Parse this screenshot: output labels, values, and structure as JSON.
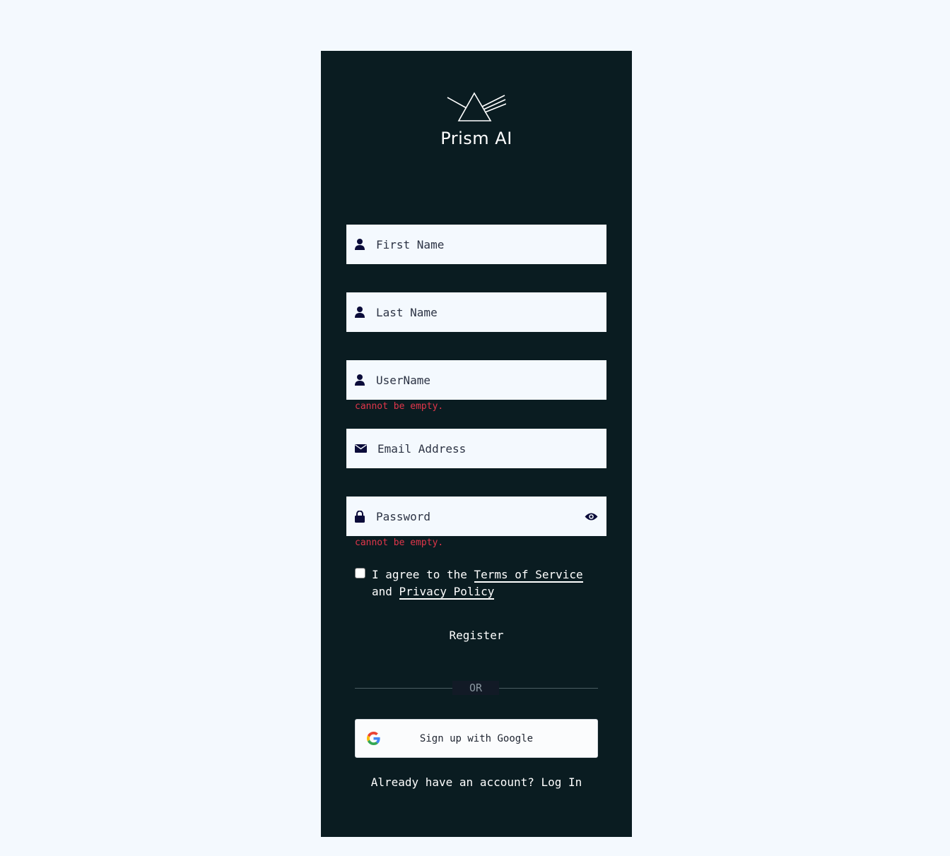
{
  "brand": {
    "name": "Prism AI",
    "logo_icon": "prism-icon"
  },
  "form": {
    "first_name": {
      "placeholder": "First Name",
      "value": "",
      "icon": "user-icon"
    },
    "last_name": {
      "placeholder": "Last Name",
      "value": "",
      "icon": "user-icon"
    },
    "username": {
      "placeholder": "UserName",
      "value": "",
      "icon": "user-icon",
      "error": "cannot be empty."
    },
    "email": {
      "placeholder": "Email Address",
      "value": "",
      "icon": "envelope-icon"
    },
    "password": {
      "placeholder": "Password",
      "value": "",
      "icon": "lock-icon",
      "toggle_icon": "eye-icon",
      "error": "cannot be empty."
    }
  },
  "agreement": {
    "checked": false,
    "prefix": "I agree to the",
    "terms_label": "Terms of Service",
    "middle": "and",
    "privacy_label": "Privacy Policy"
  },
  "register_label": "Register",
  "divider_label": "OR",
  "google": {
    "label": "Sign up with Google",
    "icon": "google-icon"
  },
  "login": {
    "prompt": "Already have an account?",
    "link_label": "Log In"
  },
  "colors": {
    "page_bg": "#f4f9fe",
    "card_bg": "#0a1c21",
    "error": "#e0364a",
    "icon": "#0b0c3a"
  }
}
